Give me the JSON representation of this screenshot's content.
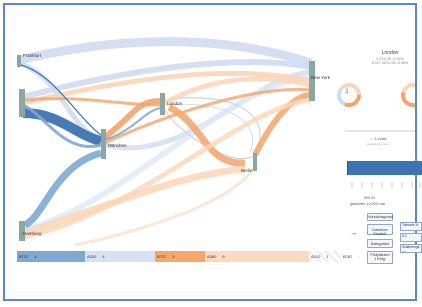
{
  "nodes": [
    {
      "id": "frankfurt",
      "label": "Frankfurt"
    },
    {
      "id": "london",
      "label": "London"
    },
    {
      "id": "newyork",
      "label": "New York"
    },
    {
      "id": "munchen",
      "label": "München"
    },
    {
      "id": "berlin",
      "label": "Berlin"
    },
    {
      "id": "hamburg",
      "label": "Hamburg"
    }
  ],
  "legend": [
    {
      "label": "B737",
      "value": "4",
      "color": "#7da9d2"
    },
    {
      "label": "A320",
      "value": "4",
      "color": "#d6e2f2"
    },
    {
      "label": "B737",
      "value": "5",
      "color": "#f6a86a"
    },
    {
      "label": "A380",
      "value": "6",
      "color": "#fbdbc0"
    },
    {
      "label": "A310",
      "value": "1",
      "color": "#eef0f5"
    },
    {
      "label": "B787",
      "value": "·",
      "color": "#ffffff"
    }
  ],
  "detail": {
    "title": "London",
    "subtitle_line1": "Σ 47/4.35 / 9.02%",
    "subtitle_line2": "EGLT 32/21.08 / 9.88%",
    "donut_left_number": "3"
  },
  "links_panel": {
    "count": "→ 3 Links",
    "sub": "selected for view"
  },
  "slider": {
    "value_label": "500.00",
    "status_label": "gewichtet: 10.00% min",
    "fill_fraction": 1.0
  },
  "buttons": {
    "overview": "Vorsichtsgrund",
    "alphabetical": "Daneben Einstell.",
    "category": "Kategorien",
    "priority_line1": "Prüfplatzen",
    "priority_line2": "1 Eing."
  },
  "arrow_glyph": "→",
  "side_fields": {
    "field1": "Toleranz %",
    "field1_value": "5          4",
    "field2": "Skalierungs.",
    "field2_value": "—"
  },
  "colors": {
    "frame": "#5b86c8",
    "node_bar": "#8aa8a0",
    "blue_dark": "#3e74b1",
    "blue_mid": "#7da9d2",
    "blue_light": "#cfdcef",
    "orange": "#f3a46a",
    "orange_light": "#fad6b8",
    "slider": "#3e74b1"
  }
}
